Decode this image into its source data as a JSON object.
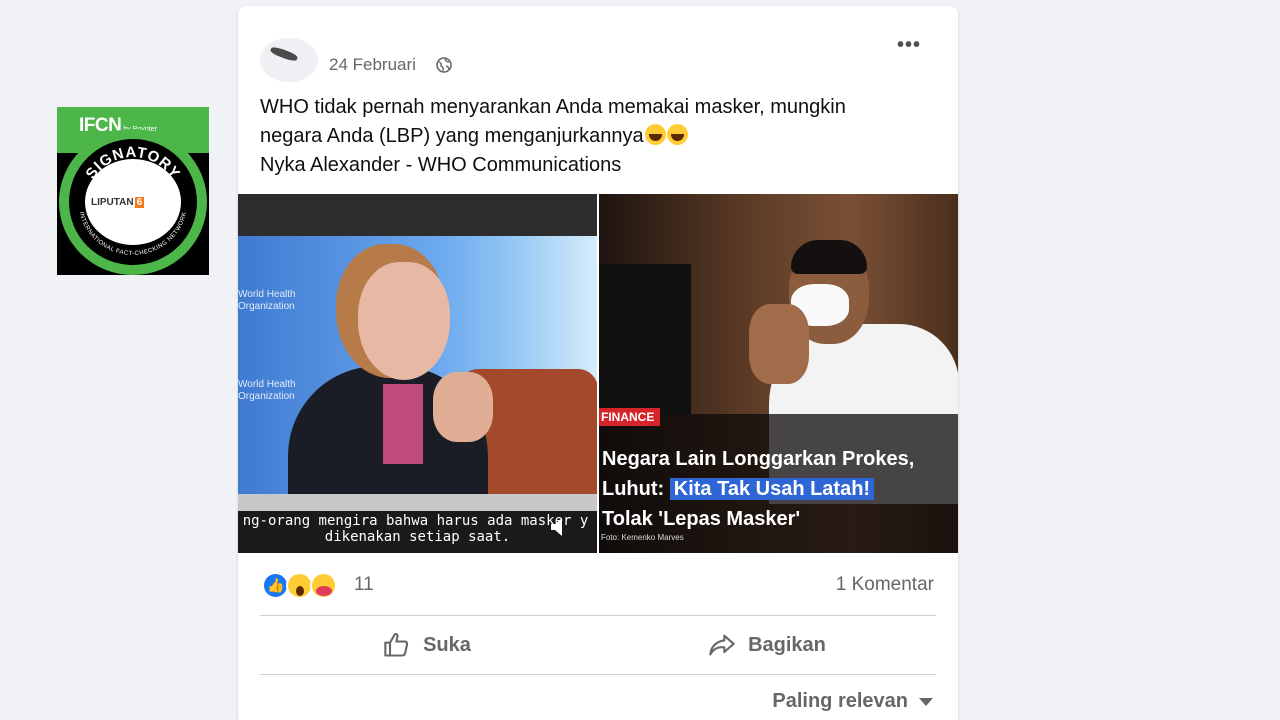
{
  "badge": {
    "logo": "IFCN",
    "logo_sub": "by Poynter",
    "ring_text": "SIGNATORY",
    "ring_bottom": "INTERNATIONAL FACT-CHECKING NETWORK",
    "brand": "LIPUTAN",
    "brand_num": "6"
  },
  "post": {
    "date": "24 Februari",
    "separator": "·",
    "text_line1": "WHO tidak pernah menyarankan Anda memakai masker, mungkin",
    "text_line2": "negara Anda (LBP) yang menganjurkannya",
    "text_line3": "Nyka Alexander - WHO Communications"
  },
  "media_left": {
    "who_label_1": "World Health Organization",
    "subtitle_line1": "ng-orang mengira bahwa harus ada masker y",
    "subtitle_line2": "dikenakan setiap saat."
  },
  "media_right": {
    "tag": "FINANCE",
    "headline_line1": "Negara Lain Longgarkan Prokes,",
    "headline_line2_prefix": "Luhut:",
    "headline_line2_highlight": "Kita Tak Usah Latah!",
    "headline_line3": "Tolak 'Lepas Masker'",
    "photo_credit": "Foto: Kemenko Marves"
  },
  "reactions": {
    "count": "11",
    "comments": "1 Komentar"
  },
  "actions": {
    "like_label": "Suka",
    "share_label": "Bagikan"
  },
  "sort": {
    "label": "Paling relevan"
  },
  "colors": {
    "facebook_blue": "#1877f2",
    "ifcn_green": "#4cb648",
    "finance_red": "#d6242b",
    "highlight_blue": "#2e66d6"
  }
}
